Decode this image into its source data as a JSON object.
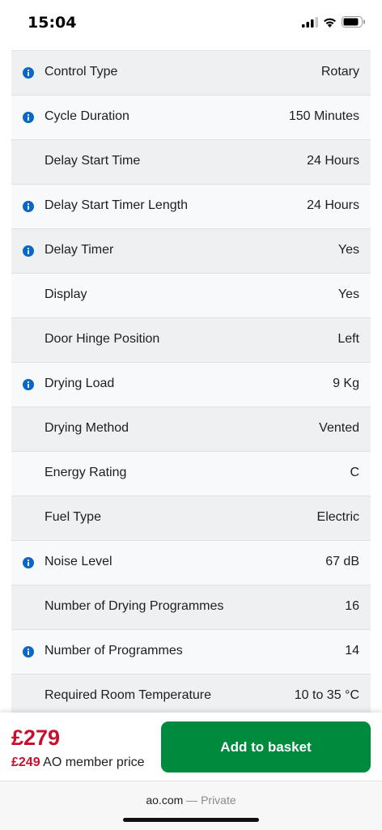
{
  "status_bar": {
    "time": "15:04"
  },
  "specs": [
    {
      "label": "Control Type",
      "value": "Rotary",
      "info": true
    },
    {
      "label": "Cycle Duration",
      "value": "150 Minutes",
      "info": true
    },
    {
      "label": "Delay Start Time",
      "value": "24 Hours",
      "info": false
    },
    {
      "label": "Delay Start Timer Length",
      "value": "24 Hours",
      "info": true
    },
    {
      "label": "Delay Timer",
      "value": "Yes",
      "info": true
    },
    {
      "label": "Display",
      "value": "Yes",
      "info": false
    },
    {
      "label": "Door Hinge Position",
      "value": "Left",
      "info": false
    },
    {
      "label": "Drying Load",
      "value": "9 Kg",
      "info": true
    },
    {
      "label": "Drying Method",
      "value": "Vented",
      "info": false
    },
    {
      "label": "Energy Rating",
      "value": "C",
      "info": false
    },
    {
      "label": "Fuel Type",
      "value": "Electric",
      "info": false
    },
    {
      "label": "Noise Level",
      "value": "67 dB",
      "info": true
    },
    {
      "label": "Number of Drying Programmes",
      "value": "16",
      "info": false
    },
    {
      "label": "Number of Programmes",
      "value": "14",
      "info": true
    },
    {
      "label": "Required Room Temperature",
      "value": "10 to 35 °C",
      "info": false
    }
  ],
  "purchase": {
    "price": "£279",
    "member_price": "£249",
    "member_label": "AO member price",
    "add_button": "Add to basket"
  },
  "browser": {
    "domain": "ao.com",
    "separator": "—",
    "mode": "Private"
  },
  "colors": {
    "price_red": "#c8102e",
    "button_green": "#008a3e",
    "info_blue": "#0b67c4"
  }
}
